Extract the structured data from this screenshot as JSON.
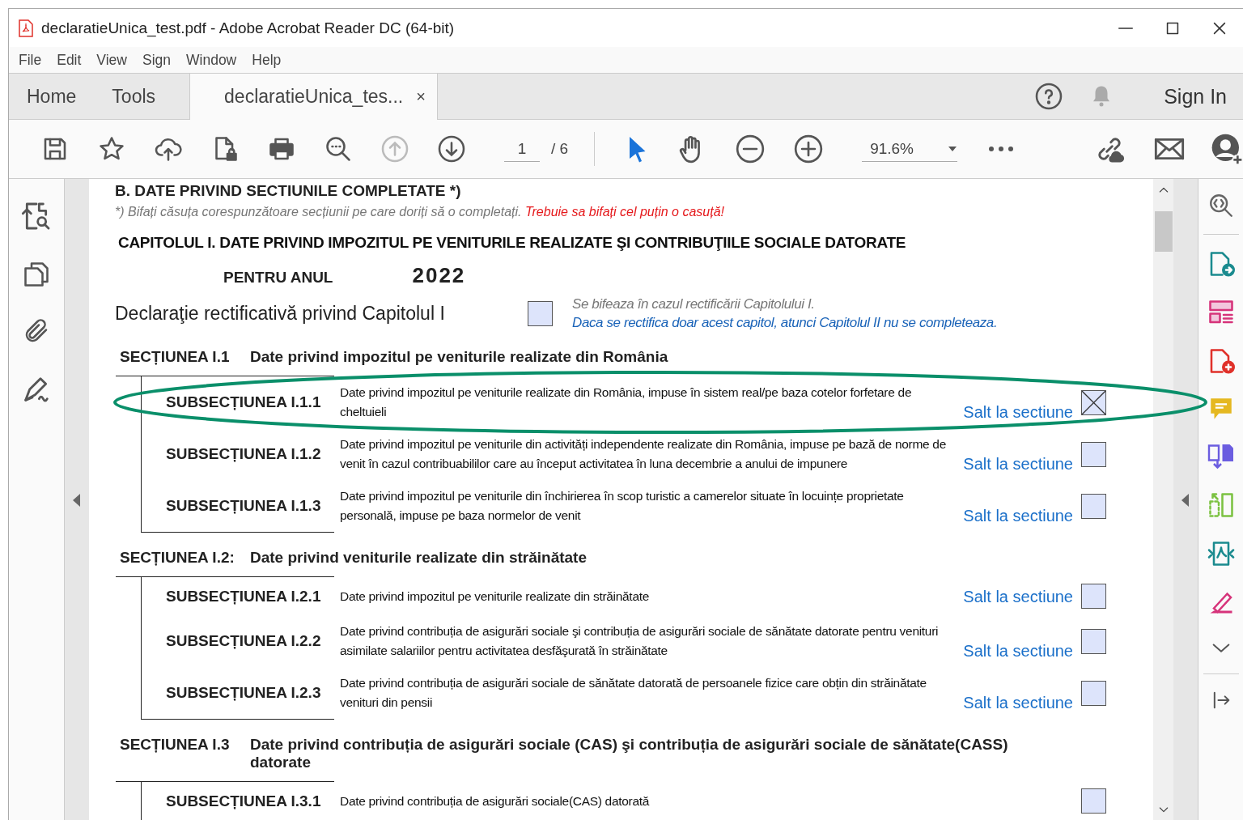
{
  "window": {
    "title": "declaratieUnica_test.pdf - Adobe Acrobat Reader DC (64-bit)"
  },
  "menu": [
    "File",
    "Edit",
    "View",
    "Sign",
    "Window",
    "Help"
  ],
  "tabs": [
    {
      "label": "Home",
      "selected": false
    },
    {
      "label": "Tools",
      "selected": false
    },
    {
      "label": "declaratieUnica_tes...",
      "selected": true,
      "close": "×"
    }
  ],
  "sign_in": "Sign In",
  "toolbar": {
    "nav": [
      {
        "kind": "up",
        "disabled": true
      },
      {
        "kind": "down",
        "disabled": false
      }
    ],
    "page": "1",
    "page_count": "/ 6",
    "zoom": "91.6%"
  },
  "document": {
    "heading": "B. DATE PRIVIND SECTIUNILE COMPLETATE *)",
    "note": "*) Bifați  căsuța corespunzătoare secțiunii pe care doriți să o completați.",
    "warning": "Trebuie sa bifați cel puțin o casuță!",
    "chapter": "CAPITOLUL I. DATE PRIVIND IMPOZITUL PE VENITURILE REALIZATE ŞI CONTRIBUŢIILE SOCIALE DATORATE",
    "year_label": "PENTRU ANUL",
    "year": "2022",
    "rectification": {
      "label": "Declaraţie rectificativă privind Capitolul I",
      "checked": false,
      "hint": "Se bifeaza în cazul rectificării Capitolului I.",
      "note": "Daca se rectifica doar acest capitol, atunci  Capitolul II  nu se completeaza."
    },
    "sections": [
      {
        "code": "SECȚIUNEA I.1",
        "title": "Date privind impozitul pe veniturile realizate din România",
        "subsections": [
          {
            "code": "SUBSECȚIUNEA I.1.1",
            "text": "Date privind impozitul pe veniturile realizate din România, impuse în sistem real/pe baza cotelor forfetare de cheltuieli",
            "link": "Salt la sectiune",
            "checked": true
          },
          {
            "code": "SUBSECȚIUNEA I.1.2",
            "text": "Date privind impozitul pe veniturile din activități independente realizate din România, impuse pe bază de norme de venit în cazul contribuabililor care au început activitatea în luna decembrie a anului de impunere",
            "link": "Salt la sectiune",
            "checked": false
          },
          {
            "code": "SUBSECȚIUNEA I.1.3",
            "text": "Date privind impozitul pe veniturile din închirierea în scop turistic a camerelor situate în locuințe proprietate personală, impuse pe baza normelor de venit",
            "link": "Salt la sectiune",
            "checked": false
          }
        ]
      },
      {
        "code": "SECȚIUNEA I.2:",
        "title": "Date privind veniturile realizate din străinătate",
        "subsections": [
          {
            "code": "SUBSECȚIUNEA I.2.1",
            "text": "Date privind impozitul pe veniturile realizate din străinătate",
            "link": "Salt la sectiune",
            "checked": false
          },
          {
            "code": "SUBSECȚIUNEA I.2.2",
            "text": "Date privind contribuția de asigurări sociale şi contribuția de asigurări sociale de sănătate datorate pentru venituri asimilate salariilor pentru activitatea desfăşurată în străinătate",
            "link": "Salt la sectiune",
            "checked": false
          },
          {
            "code": "SUBSECȚIUNEA I.2.3",
            "text": "Date privind contribuția de asigurări sociale de sănătate datorată de persoanele fizice care obțin din străinătate venituri din pensii",
            "link": "Salt la sectiune",
            "checked": false
          }
        ]
      },
      {
        "code": "SECȚIUNEA I.3",
        "title": "Date privind contribuția de asigurări sociale (CAS) şi contribuția de asigurări sociale de sănătate(CASS) datorate",
        "subsections": [
          {
            "code": "SUBSECȚIUNEA I.3.1",
            "text": "Date privind contribuția de asigurări sociale(CAS) datorată",
            "checked": false
          }
        ]
      }
    ]
  }
}
